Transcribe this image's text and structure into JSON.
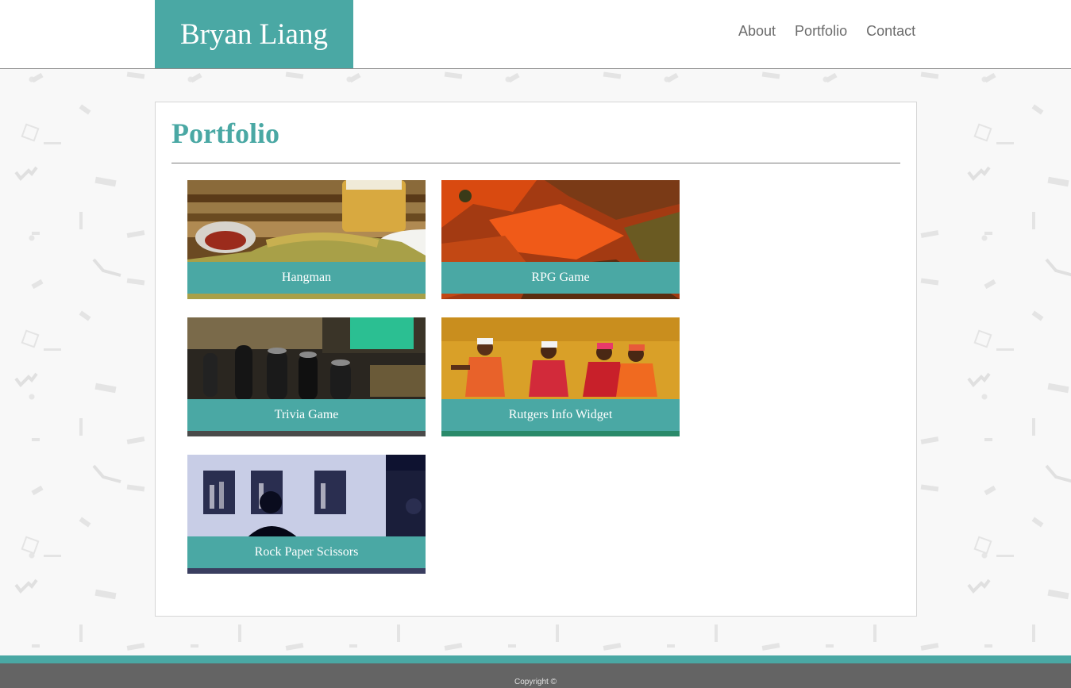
{
  "header": {
    "brand": "Bryan Liang",
    "nav": [
      {
        "label": "About"
      },
      {
        "label": "Portfolio"
      },
      {
        "label": "Contact"
      }
    ]
  },
  "main": {
    "title": "Portfolio",
    "projects": [
      {
        "name": "Hangman"
      },
      {
        "name": "RPG Game"
      },
      {
        "name": "Trivia Game"
      },
      {
        "name": "Rutgers Info Widget"
      },
      {
        "name": "Rock Paper Scissors"
      }
    ]
  },
  "footer": {
    "copyright": "Copyright ©"
  },
  "colors": {
    "accent": "#4aa8a4",
    "footer": "#646464",
    "nav_text": "#6b6b6b"
  }
}
